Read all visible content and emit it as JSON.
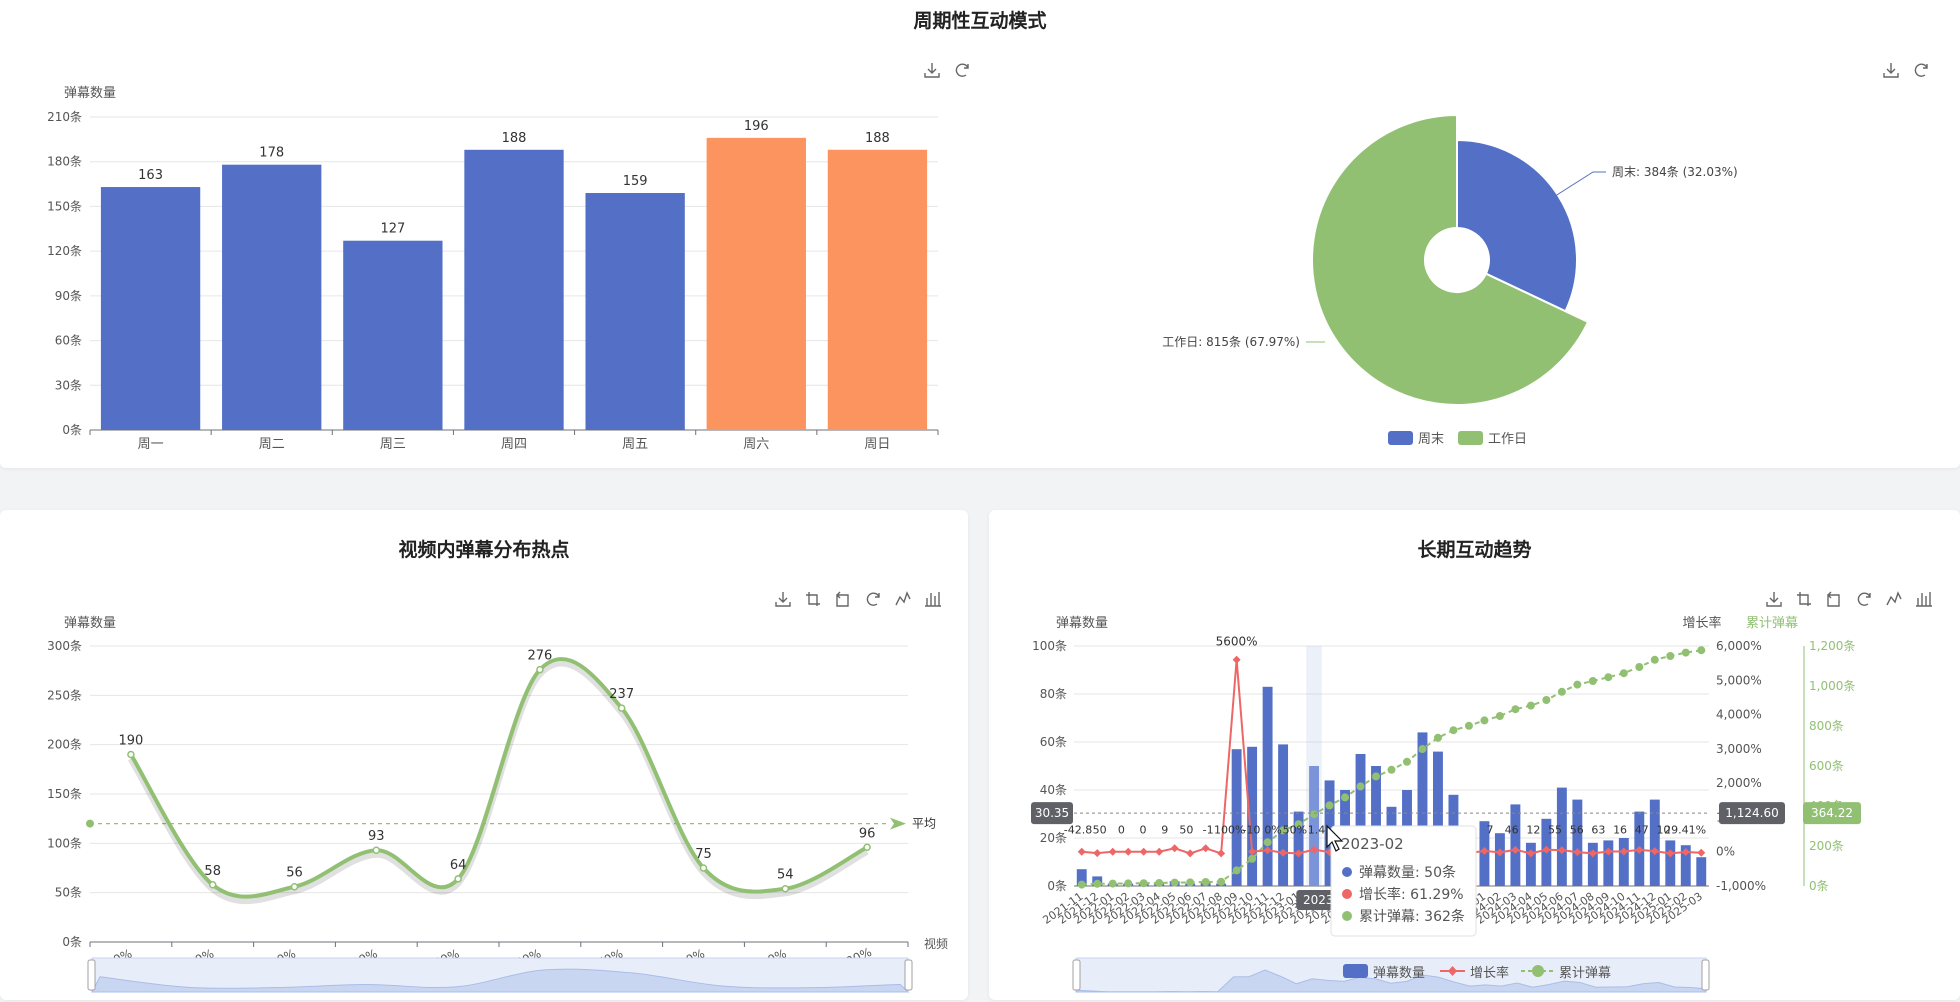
{
  "colors": {
    "blue": "#5470c6",
    "orange": "#fc9460",
    "green": "#91c073",
    "red": "#ee6666",
    "grid": "#e6e6e6",
    "axis": "#6e7079",
    "text": "#555555"
  },
  "weekly": {
    "title": "周期性互动模式",
    "bar": {
      "ylabel": "弹幕数量",
      "unit": "条",
      "yticks": [
        0,
        30,
        60,
        90,
        120,
        150,
        180,
        210
      ],
      "categories": [
        "周一",
        "周二",
        "周三",
        "周四",
        "周五",
        "周六",
        "周日"
      ],
      "values": [
        163,
        178,
        127,
        188,
        159,
        196,
        188
      ],
      "highlight": [
        false,
        false,
        false,
        false,
        false,
        true,
        true
      ]
    },
    "pie": {
      "slices": [
        {
          "name": "周末",
          "value": 384,
          "label": "周末: 384条 (32.03%)"
        },
        {
          "name": "工作日",
          "value": 815,
          "label": "工作日: 815条 (67.97%)"
        }
      ],
      "legend": [
        "周末",
        "工作日"
      ]
    }
  },
  "hotspot": {
    "title": "视频内弹幕分布热点",
    "ylabel": "弹幕数量",
    "xlabel_partial": "视频",
    "avg_label_partial": "平均",
    "unit": "条",
    "yticks": [
      0,
      50,
      100,
      150,
      200,
      250,
      300
    ],
    "x": [
      "10%",
      "20%",
      "30%",
      "40%",
      "50%",
      "60%",
      "70%",
      "80%",
      "90%",
      "100%"
    ],
    "values": [
      190,
      58,
      56,
      93,
      64,
      276,
      237,
      75,
      54,
      96
    ],
    "average": 120
  },
  "trend": {
    "title": "长期互动趋势",
    "ylabel_left": "弹幕数量",
    "ylabel_rate": "增长率",
    "ylabel_cum": "累计弹幕",
    "left_ticks": [
      "0条",
      "20条",
      "40条",
      "60条",
      "80条",
      "100条"
    ],
    "rate_ticks": [
      "-1,000%",
      "0%",
      "1,000%",
      "2,000%",
      "3,000%",
      "4,000%",
      "5,000%",
      "6,000%"
    ],
    "cum_ticks": [
      "0条",
      "200条",
      "400条",
      "600条",
      "800条",
      "1,000条",
      "1,200条"
    ],
    "months": [
      "2021-11",
      "2021-12",
      "2022-01",
      "2022-02",
      "2022-03",
      "2022-04",
      "2022-05",
      "2022-06",
      "2022-07",
      "2022-08",
      "2022-09",
      "2022-10",
      "2022-11",
      "2022-12",
      "2023-01",
      "2023-02",
      "2023-03",
      "2023-04",
      "2023-05",
      "2023-06",
      "2023-07",
      "2023-08",
      "2023-09",
      "2023-10",
      "2023-11",
      "2023-12",
      "2024-01",
      "2024-02",
      "2024-03",
      "2024-04",
      "2024-05",
      "2024-06",
      "2024-07",
      "2024-08",
      "2024-09",
      "2024-10",
      "2024-11",
      "2024-12",
      "2025-01",
      "2025-02",
      "2025-03"
    ],
    "counts": [
      7,
      4,
      1,
      1,
      1,
      1,
      2,
      1,
      2,
      1,
      57,
      58,
      83,
      59,
      31,
      50,
      44,
      40,
      55,
      50,
      33,
      40,
      64,
      56,
      38,
      22,
      27,
      22,
      34,
      18,
      28,
      41,
      36,
      18,
      19,
      20,
      31,
      36,
      19,
      17,
      12
    ],
    "growth": [
      0,
      -42,
      0,
      0,
      0,
      0,
      100,
      -50,
      100,
      -50,
      5600,
      1.7,
      43,
      -29,
      -47,
      61.29,
      -12,
      -9,
      37,
      -9,
      -34,
      21,
      60,
      -12,
      -32,
      -42,
      23,
      -19,
      55,
      -47,
      56,
      46,
      -12,
      -50,
      5.6,
      5,
      55,
      16,
      -47,
      -10,
      -29.41
    ],
    "pointer": {
      "left_value": "30.35",
      "rate_value": "1,124.60",
      "cum_value": "364.22"
    },
    "cursor_month_index": 15,
    "tooltip": {
      "title": "2023-02",
      "rows": [
        "弹幕数量: 50条",
        "增长率: 61.29%",
        "累计弹幕: 362条"
      ],
      "axis_badge": "2023"
    },
    "peak_label": "5600%",
    "legend": [
      "弹幕数量",
      "增长率",
      "累计弹幕"
    ],
    "overlay_labels": [
      "-42.8",
      "50",
      "0",
      "0",
      "9",
      "50",
      "-1",
      "100%",
      "-10",
      "0%",
      "50%",
      "1.4",
      "3",
      "28",
      "47",
      "61",
      "21",
      "47",
      "52",
      "7",
      "46",
      "12",
      "55",
      "56",
      "63",
      "16",
      "47",
      "10",
      "29.41%"
    ]
  }
}
